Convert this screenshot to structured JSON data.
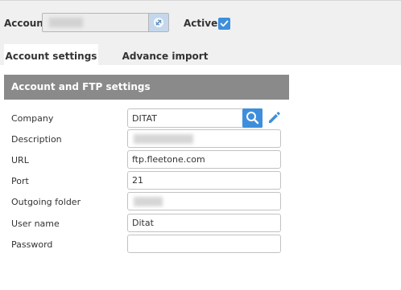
{
  "header": {
    "account_label": "Account",
    "account_value": "",
    "active_label": "Active",
    "active_checked": true
  },
  "tabs": [
    {
      "label": "Account settings",
      "active": true
    },
    {
      "label": "Advance import settings",
      "active": false
    }
  ],
  "section": {
    "title": "Account and FTP settings"
  },
  "form": {
    "company_label": "Company",
    "company_value": "DITAT",
    "description_label": "Description",
    "description_value": "",
    "url_label": "URL",
    "url_value": "ftp.fleetone.com",
    "port_label": "Port",
    "port_value": "21",
    "outgoing_folder_label": "Outgoing folder",
    "outgoing_folder_value": "",
    "user_name_label": "User name",
    "user_name_value": "Ditat",
    "password_label": "Password",
    "password_value": ""
  },
  "colors": {
    "accent": "#3d8fdc",
    "header_bg": "#8a8a8a",
    "top_bg": "#f0f0f0"
  },
  "icons": {
    "account_lookup": "link-icon",
    "company_search": "search-icon",
    "company_edit": "pencil-icon",
    "active_check": "check-icon"
  }
}
